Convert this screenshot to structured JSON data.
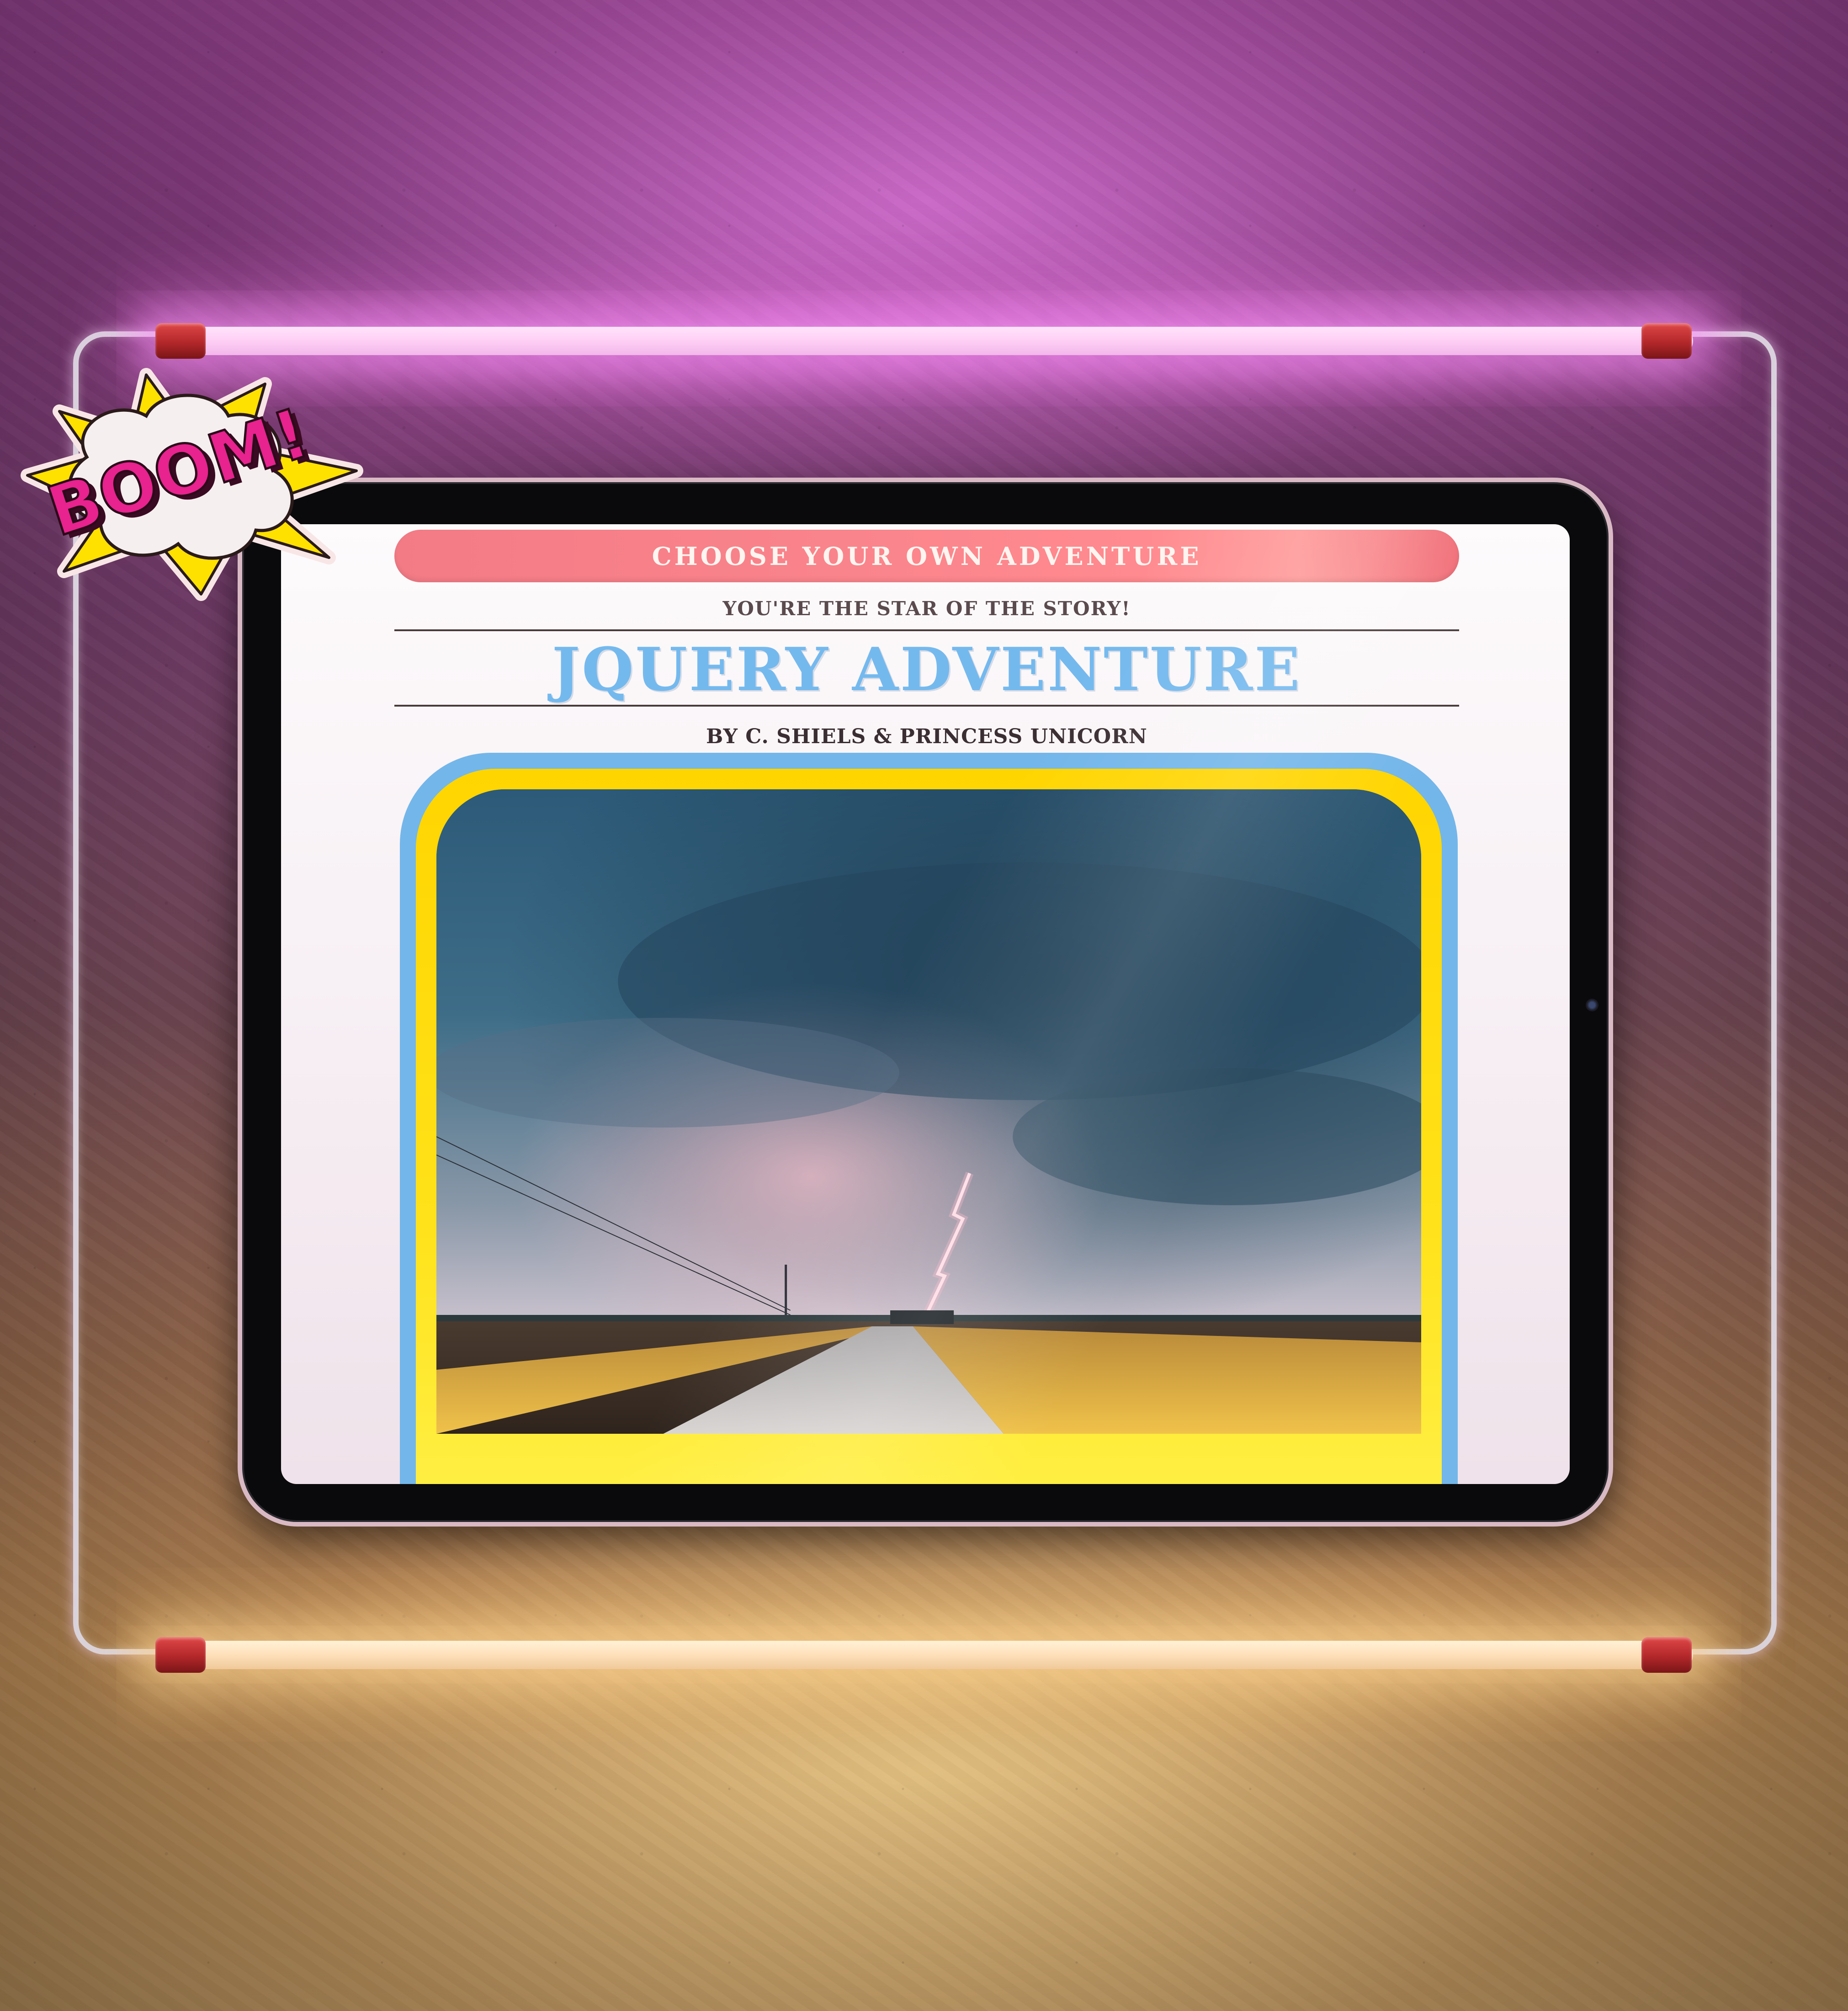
{
  "page": {
    "banner_text": "CHOOSE YOUR OWN ADVENTURE",
    "tagline": "YOU'RE THE STAR OF THE STORY!",
    "title": "JQUERY ADVENTURE",
    "byline": "BY C. SHIELS & PRINCESS UNICORN",
    "sticker_text": "BOOM!"
  },
  "colors": {
    "banner": "#f37b86",
    "title": "#74b9ee",
    "cover_outer": "#73b6ea",
    "cover_inner": "#ffd500",
    "sticker": "#e8228e"
  },
  "icons": {
    "sticker": "boom-burst-icon",
    "camera": "front-camera-icon"
  }
}
